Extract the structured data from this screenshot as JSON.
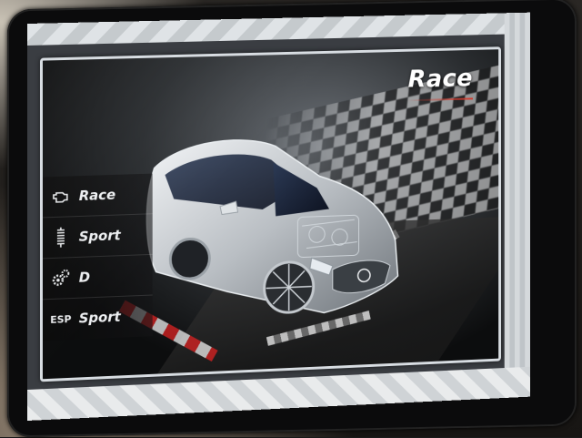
{
  "drive_screen": {
    "title": "Race",
    "settings": [
      {
        "icon": "engine-icon",
        "label": "Race"
      },
      {
        "icon": "suspension-icon",
        "label": "Sport"
      },
      {
        "icon": "transmission-gears-icon",
        "label": "D"
      },
      {
        "icon": "esp-icon",
        "icon_text": "ESP",
        "label": "Sport"
      }
    ]
  },
  "colors": {
    "accent_red": "#d23b2f",
    "frame": "#d8dde2",
    "text": "#ffffff"
  }
}
